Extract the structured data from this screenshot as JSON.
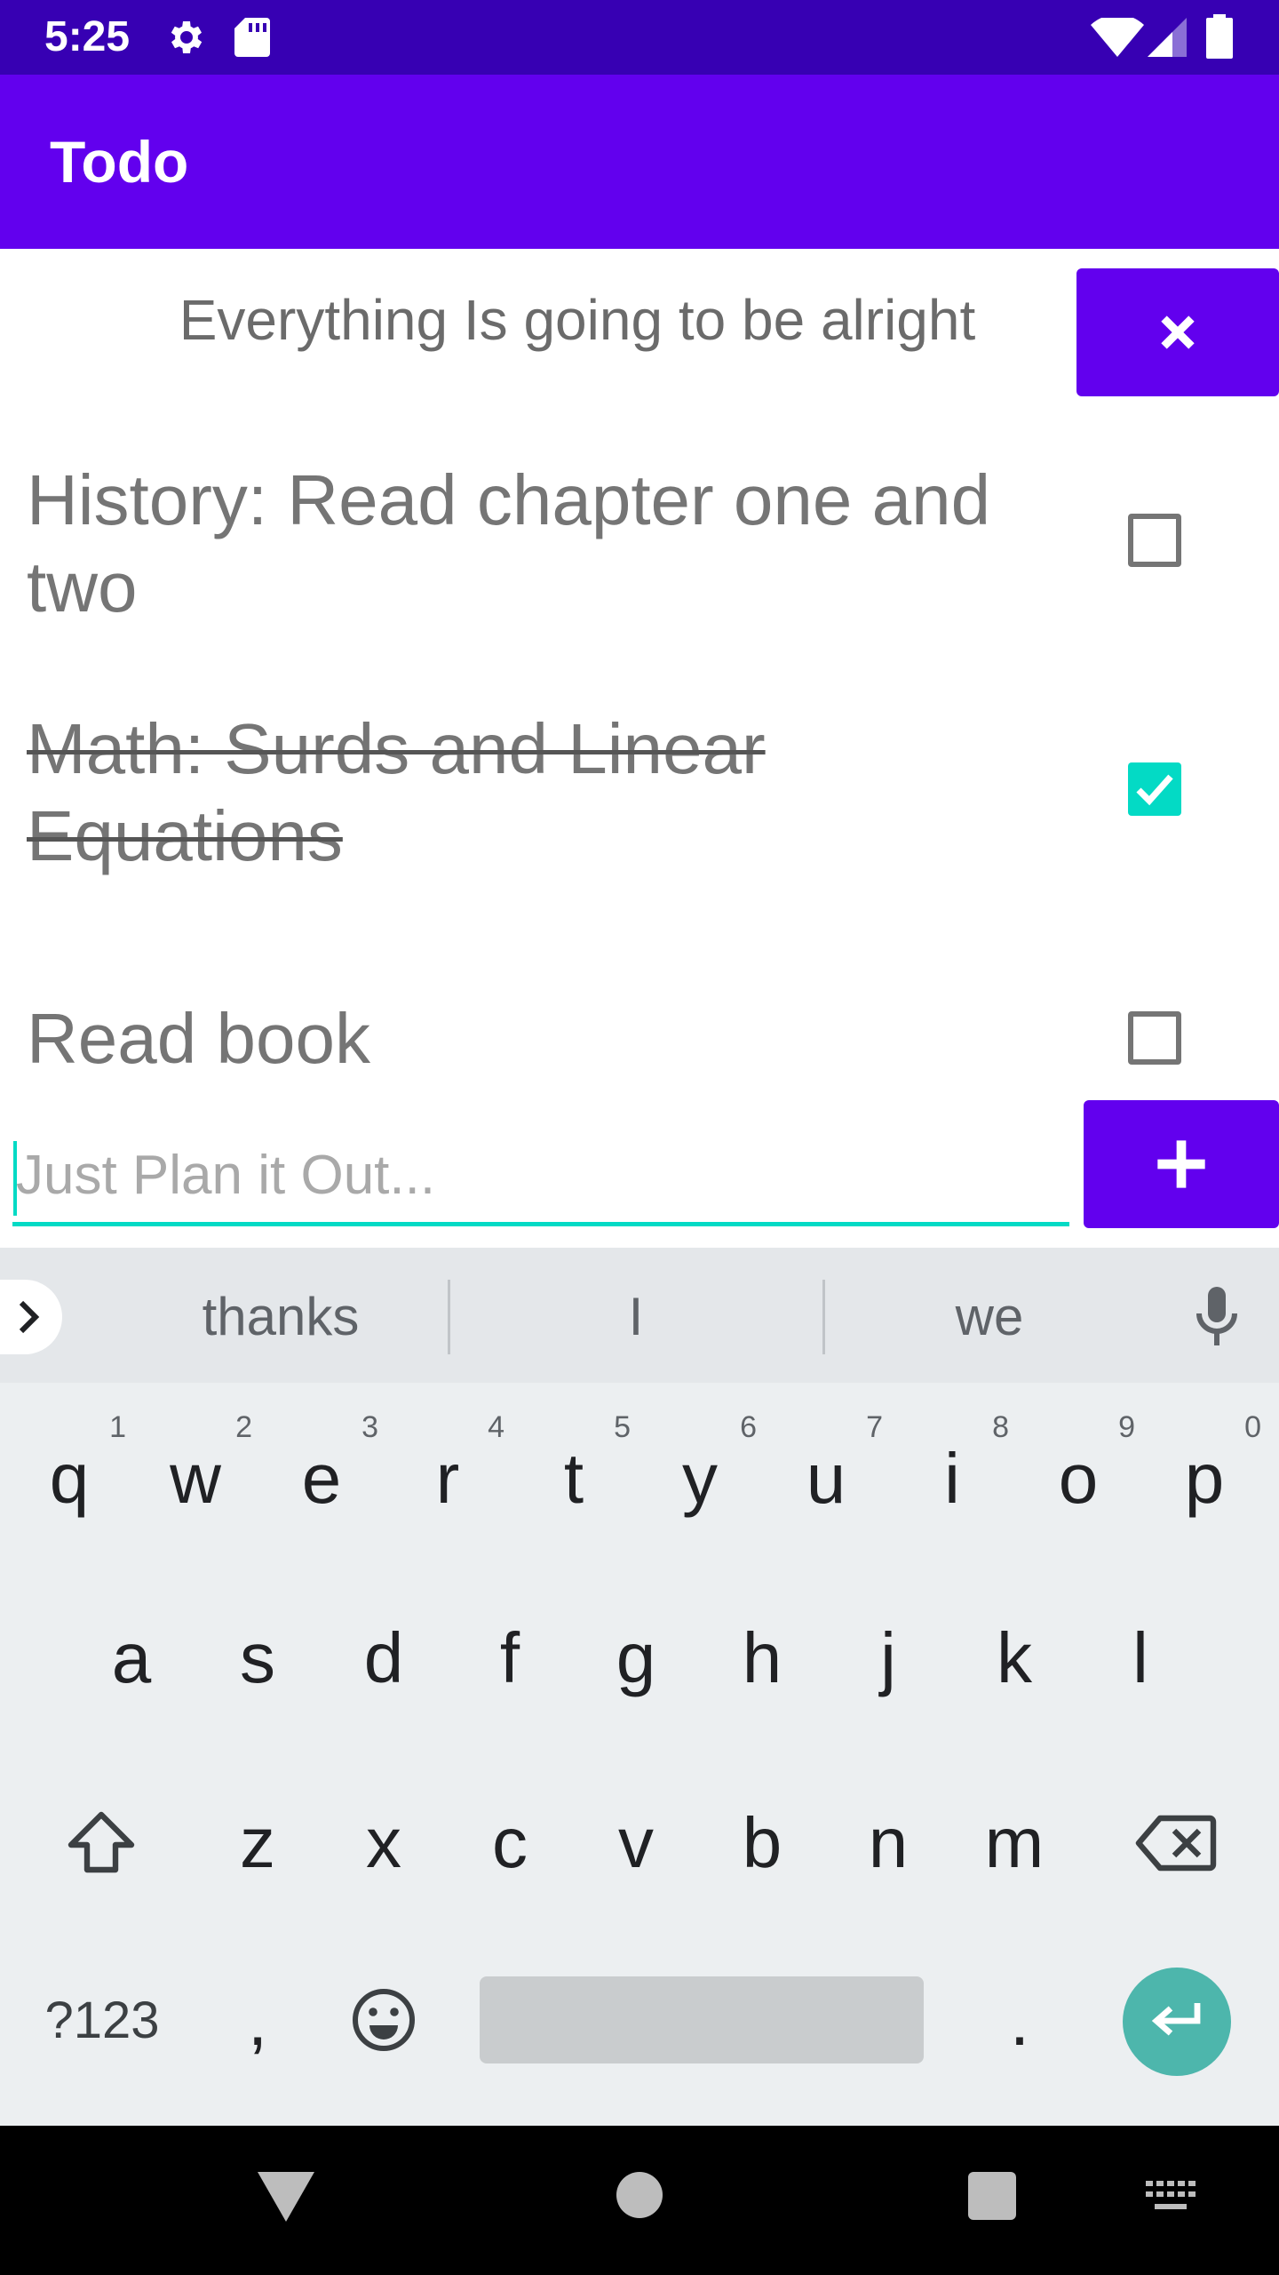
{
  "status_bar": {
    "time": "5:25"
  },
  "app_bar": {
    "title": "Todo"
  },
  "motto": "Everything Is going to be alright",
  "todos": [
    {
      "text": "History: Read chapter one and two",
      "checked": false
    },
    {
      "text": "Math: Surds and Linear Equations",
      "checked": true
    },
    {
      "text": "Read book",
      "checked": false
    }
  ],
  "input": {
    "placeholder": "Just Plan it Out...",
    "value": ""
  },
  "keyboard": {
    "suggestions": [
      "thanks",
      "I",
      "we"
    ],
    "row1": [
      {
        "key": "q",
        "hint": "1"
      },
      {
        "key": "w",
        "hint": "2"
      },
      {
        "key": "e",
        "hint": "3"
      },
      {
        "key": "r",
        "hint": "4"
      },
      {
        "key": "t",
        "hint": "5"
      },
      {
        "key": "y",
        "hint": "6"
      },
      {
        "key": "u",
        "hint": "7"
      },
      {
        "key": "i",
        "hint": "8"
      },
      {
        "key": "o",
        "hint": "9"
      },
      {
        "key": "p",
        "hint": "0"
      }
    ],
    "row2": [
      "a",
      "s",
      "d",
      "f",
      "g",
      "h",
      "j",
      "k",
      "l"
    ],
    "row3": [
      "z",
      "x",
      "c",
      "v",
      "b",
      "n",
      "m"
    ],
    "symbols_label": "?123",
    "comma": ",",
    "period": "."
  },
  "colors": {
    "primary": "#6200EE",
    "primary_dark": "#3700B3",
    "accent": "#03DAC5",
    "enter": "#4DB6AC"
  }
}
